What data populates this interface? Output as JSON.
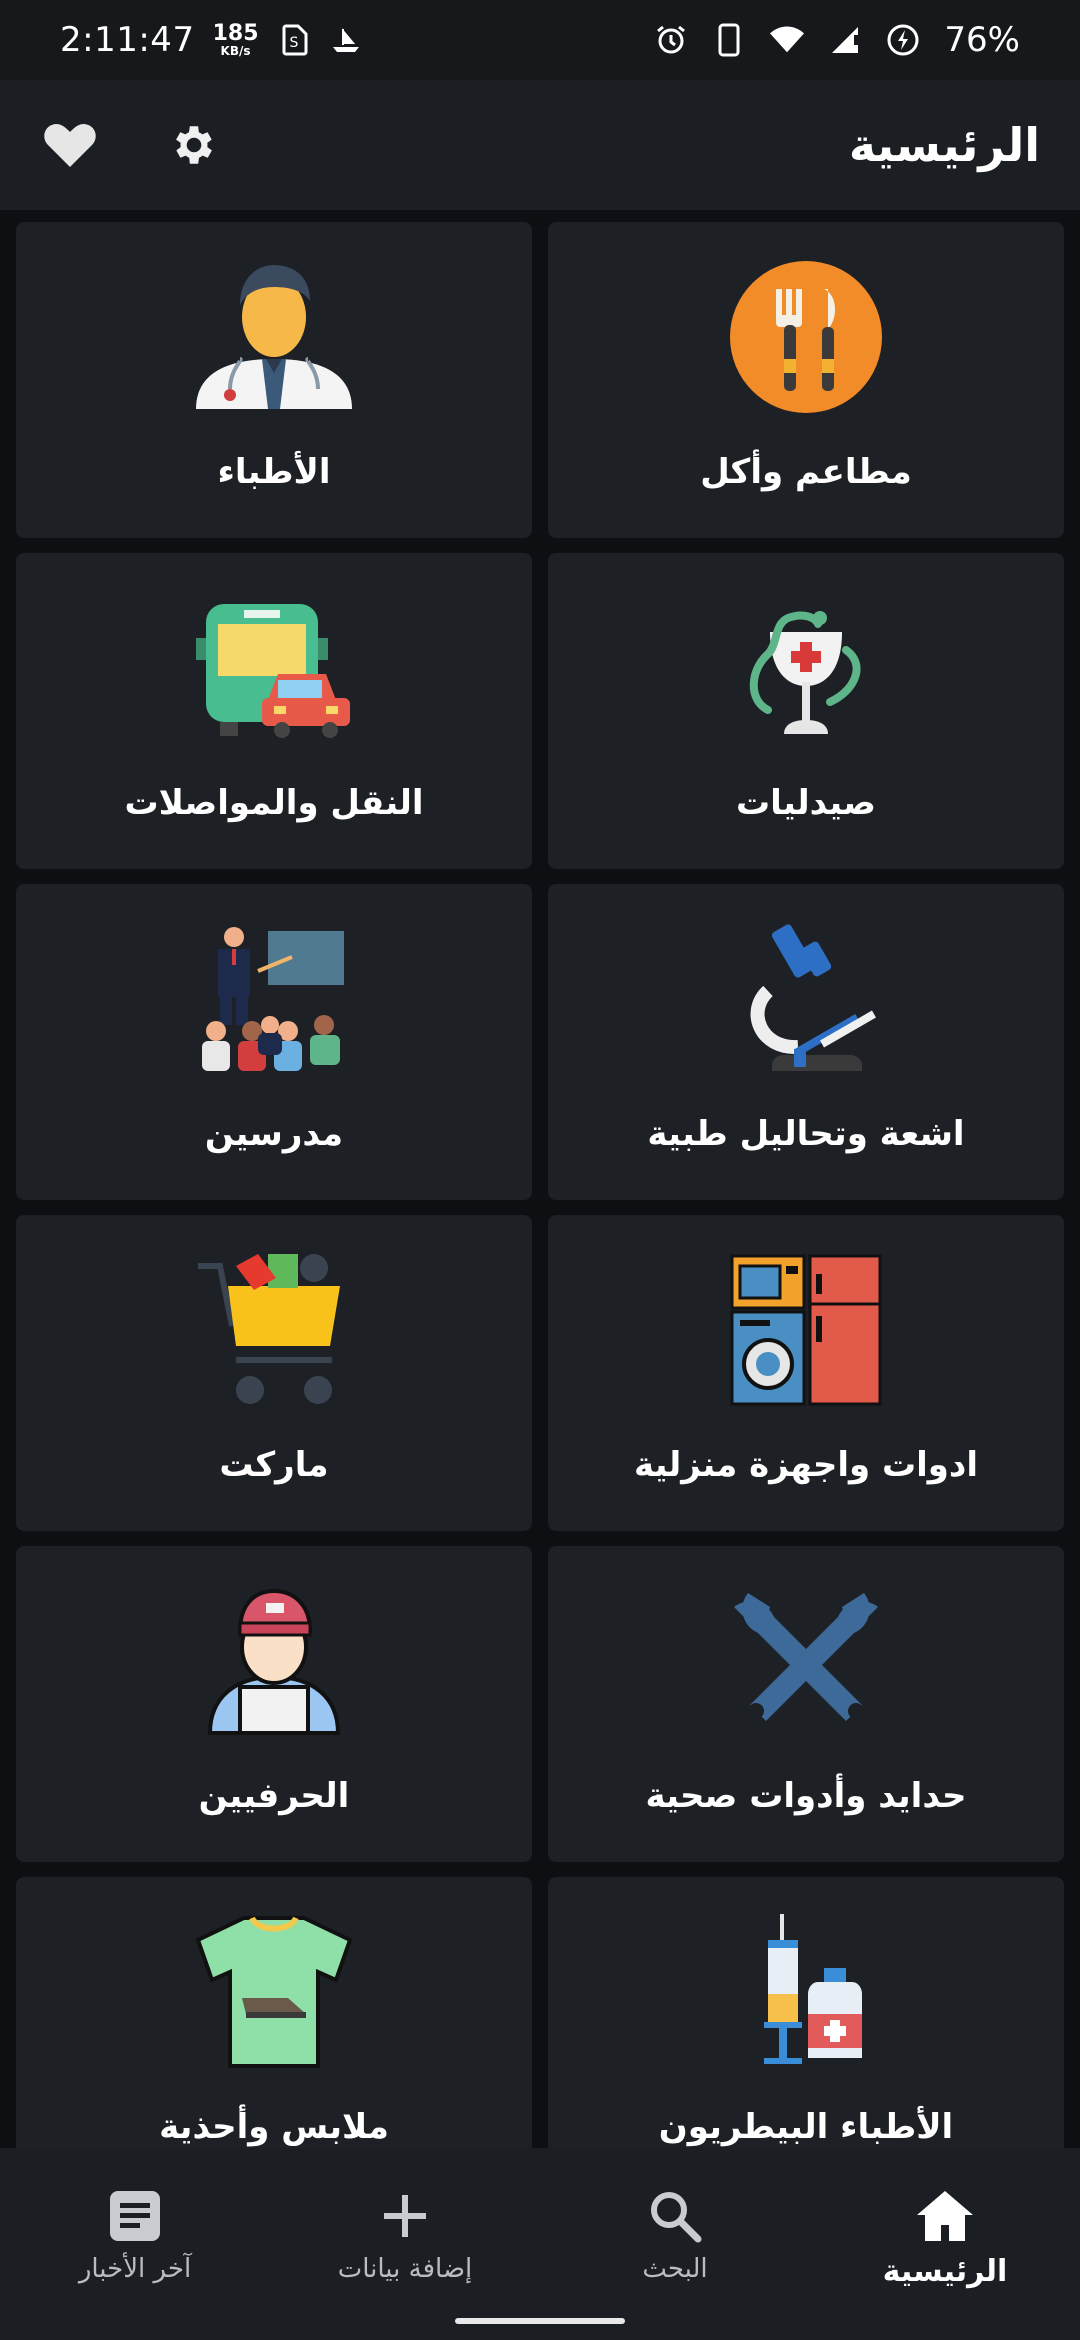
{
  "status_bar": {
    "time": "2:11:47",
    "speed_value": "185",
    "speed_unit": "KB/s",
    "battery": "76%",
    "icons": [
      "sim-icon",
      "boat-icon",
      "alarm-icon",
      "phone-icon",
      "wifi-icon",
      "signal-icon",
      "battery-saver-icon"
    ]
  },
  "app_bar": {
    "title": "الرئيسية",
    "favorites_icon": "heart-icon",
    "settings_icon": "gear-icon"
  },
  "categories": [
    {
      "label": "مطاعم وأكل",
      "icon": "restaurant-icon"
    },
    {
      "label": "الأطباء",
      "icon": "doctor-icon"
    },
    {
      "label": "صيدليات",
      "icon": "pharmacy-icon"
    },
    {
      "label": "النقل والمواصلات",
      "icon": "transport-icon"
    },
    {
      "label": "اشعة وتحاليل طبية",
      "icon": "microscope-icon"
    },
    {
      "label": "مدرسين",
      "icon": "teacher-icon"
    },
    {
      "label": "ادوات واجهزة منزلية",
      "icon": "appliances-icon"
    },
    {
      "label": "ماركت",
      "icon": "cart-icon"
    },
    {
      "label": "حدايد وأدوات صحية",
      "icon": "wrench-icon"
    },
    {
      "label": "الحرفيين",
      "icon": "craftsman-icon"
    },
    {
      "label": "الأطباء البيطريون",
      "icon": "vet-icon"
    },
    {
      "label": "ملابس وأحذية",
      "icon": "clothes-icon"
    }
  ],
  "bottom_nav": [
    {
      "label": "الرئيسية",
      "icon": "home-icon",
      "active": true
    },
    {
      "label": "البحث",
      "icon": "search-icon",
      "active": false
    },
    {
      "label": "إضافة بيانات",
      "icon": "plus-icon",
      "active": false
    },
    {
      "label": "آخر الأخبار",
      "icon": "news-icon",
      "active": false
    }
  ]
}
